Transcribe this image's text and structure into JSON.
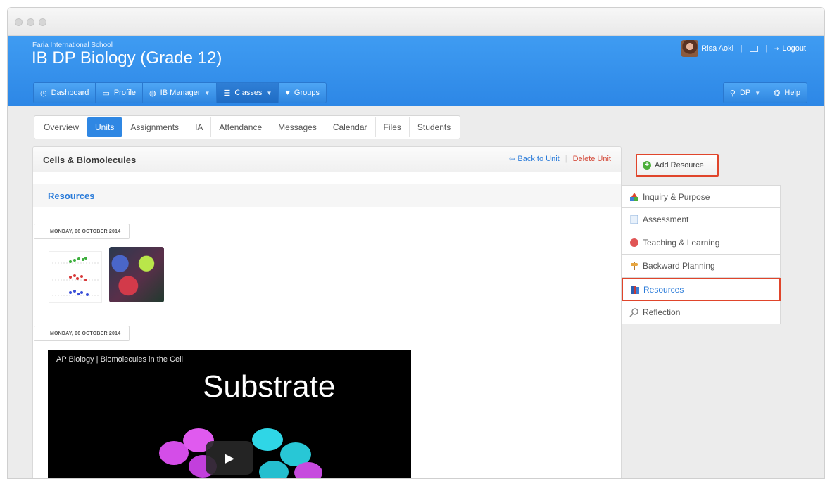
{
  "header": {
    "school": "Faria International School",
    "course_title": "IB DP Biology (Grade 12)",
    "user_name": "Risa Aoki",
    "logout_label": "Logout"
  },
  "nav": {
    "items": [
      {
        "label": "Dashboard",
        "icon": "dashboard-icon"
      },
      {
        "label": "Profile",
        "icon": "profile-card-icon"
      },
      {
        "label": "IB Manager",
        "icon": "globe-icon",
        "has_dropdown": true
      },
      {
        "label": "Classes",
        "icon": "classes-icon",
        "has_dropdown": true,
        "active": true
      },
      {
        "label": "Groups",
        "icon": "groups-icon"
      }
    ],
    "right": [
      {
        "label": "DP",
        "icon": "search-icon",
        "has_dropdown": true
      },
      {
        "label": "Help",
        "icon": "lifebuoy-icon"
      }
    ]
  },
  "tabs": [
    "Overview",
    "Units",
    "Assignments",
    "IA",
    "Attendance",
    "Messages",
    "Calendar",
    "Files",
    "Students"
  ],
  "active_tab": "Units",
  "unit": {
    "title": "Cells & Biomolecules",
    "back_link": "Back to Unit",
    "delete_link": "Delete Unit"
  },
  "resources": {
    "section_title": "Resources",
    "dates": [
      "MONDAY, 06 OCTOBER 2014",
      "MONDAY, 06 OCTOBER 2014"
    ],
    "video": {
      "caption": "AP Biology | Biomolecules in the Cell",
      "title_text": "Substrate"
    }
  },
  "add_resource_label": "Add Resource",
  "side_menu": [
    {
      "label": "Inquiry & Purpose",
      "icon": "blocks-icon"
    },
    {
      "label": "Assessment",
      "icon": "document-icon"
    },
    {
      "label": "Teaching & Learning",
      "icon": "red-dot-icon"
    },
    {
      "label": "Backward Planning",
      "icon": "signpost-icon"
    },
    {
      "label": "Resources",
      "icon": "books-icon",
      "active": true
    },
    {
      "label": "Reflection",
      "icon": "magnifier-icon"
    }
  ],
  "colors": {
    "header_blue": "#3f9cf2",
    "accent_blue": "#2f87e3",
    "highlight_red": "#e0452b",
    "link_blue": "#2a7bd9"
  }
}
